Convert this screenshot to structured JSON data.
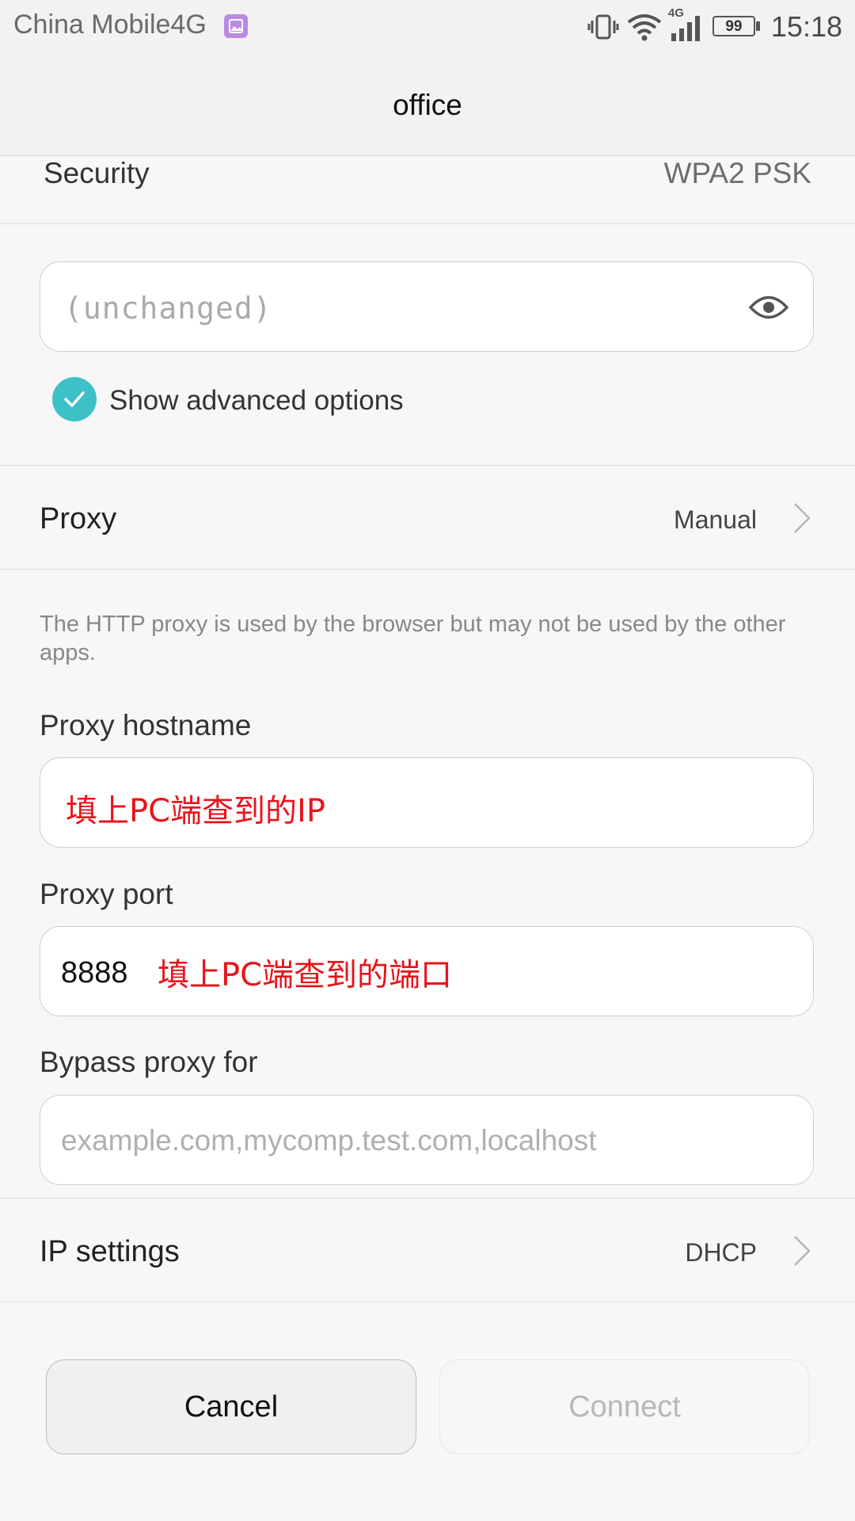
{
  "status_bar": {
    "carrier": "China Mobile4G",
    "network_badge": "4G",
    "battery": "99",
    "time": "15:18"
  },
  "header": {
    "title": "office"
  },
  "security": {
    "label": "Security",
    "value": "WPA2 PSK"
  },
  "password": {
    "placeholder": "(unchanged)"
  },
  "advanced": {
    "label": "Show advanced options",
    "checked": true
  },
  "proxy": {
    "label": "Proxy",
    "value": "Manual"
  },
  "proxy_hint": "The HTTP proxy is used by the browser but may not be used by the other apps.",
  "hostname": {
    "label": "Proxy hostname",
    "annotation": "填上PC端查到的IP"
  },
  "port": {
    "label": "Proxy port",
    "value": "8888",
    "annotation": "填上PC端查到的端口"
  },
  "bypass": {
    "label": "Bypass proxy for",
    "placeholder": "example.com,mycomp.test.com,localhost"
  },
  "ip_settings": {
    "label": "IP settings",
    "value": "DHCP"
  },
  "buttons": {
    "cancel": "Cancel",
    "connect": "Connect"
  },
  "colors": {
    "accent": "#3cc1c9",
    "annotation": "#e8141c"
  }
}
